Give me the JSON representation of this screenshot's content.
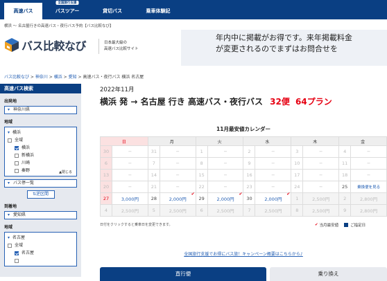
{
  "nav": {
    "tabs": [
      {
        "label": "高速バス"
      },
      {
        "label": "バスツアー",
        "badge": "全国旅行支援"
      },
      {
        "label": "貸切バス"
      },
      {
        "label": "乗車体験記"
      }
    ]
  },
  "top_breadcrumb": "横浜 〜 名古屋行きの高速バス・夜行バス予約【バス比較なび】",
  "logo": {
    "text": "バス比較なび",
    "sub_line1": "日本最大級の",
    "sub_line2": "高速バス比較サイト"
  },
  "ad": {
    "line1": "年内中に掲載がお得です。来年掲載料金",
    "line2": "が変更されるのでまずはお問合せを"
  },
  "breadcrumb": {
    "items": [
      "バス比較なび",
      "神奈川",
      "横浜",
      "愛知",
      "高速バス・夜行バス 横浜 名古屋"
    ],
    "sep": " > "
  },
  "sidebar": {
    "title": "高速バス検索",
    "departure_label": "出発地",
    "departure_pref": "神奈川県",
    "region_label": "地域",
    "departure_region": "横浜",
    "departure_options": [
      {
        "label": "全域",
        "checked": false,
        "indent": false
      },
      {
        "label": "横浜",
        "checked": true,
        "indent": true
      },
      {
        "label": "新横浜",
        "checked": false,
        "indent": true
      },
      {
        "label": "川崎",
        "checked": false,
        "indent": true
      },
      {
        "label": "秦野",
        "checked": false,
        "indent": true
      }
    ],
    "close_label": "▲閉じる",
    "stop_list": "バス停一覧",
    "swap_label": "⇅逆区間",
    "arrival_label": "到着地",
    "arrival_pref": "愛知県",
    "arrival_region_label": "地域",
    "arrival_region": "名古屋",
    "arrival_options": [
      {
        "label": "全域",
        "checked": false,
        "indent": false
      },
      {
        "label": "名古屋",
        "checked": true,
        "indent": true
      },
      {
        "label": "",
        "checked": false,
        "indent": true
      }
    ]
  },
  "main": {
    "date": "2022年11月",
    "title_prefix": "横浜 発 → 名古屋 行き 高速バス・夜行バス",
    "count_runs": "32便",
    "count_plans": "64プラン"
  },
  "calendar": {
    "title": "11月最安値カレンダー",
    "headers": [
      "日",
      "月",
      "火",
      "水",
      "木",
      "金"
    ],
    "rows": [
      [
        {
          "d": "30",
          "p": "−"
        },
        {
          "d": "31",
          "p": "−"
        },
        {
          "d": "1",
          "p": "−"
        },
        {
          "d": "2",
          "p": "−"
        },
        {
          "d": "3",
          "p": "−"
        },
        {
          "d": "4",
          "p": "−"
        }
      ],
      [
        {
          "d": "6",
          "p": "−"
        },
        {
          "d": "7",
          "p": "−"
        },
        {
          "d": "8",
          "p": "−"
        },
        {
          "d": "9",
          "p": "−"
        },
        {
          "d": "10",
          "p": "−"
        },
        {
          "d": "11",
          "p": "−"
        }
      ],
      [
        {
          "d": "13",
          "p": "−"
        },
        {
          "d": "14",
          "p": "−"
        },
        {
          "d": "15",
          "p": "−"
        },
        {
          "d": "16",
          "p": "−"
        },
        {
          "d": "17",
          "p": "−"
        },
        {
          "d": "18",
          "p": "−"
        }
      ],
      [
        {
          "d": "20",
          "p": "−"
        },
        {
          "d": "21",
          "p": "−"
        },
        {
          "d": "22",
          "p": "−"
        },
        {
          "d": "23",
          "p": "−"
        },
        {
          "d": "24",
          "p": "−"
        },
        {
          "d": "25",
          "p": "乗換便を見る"
        }
      ],
      [
        {
          "d": "27",
          "p": "3,000円"
        },
        {
          "d": "28",
          "p": "2,000円"
        },
        {
          "d": "29",
          "p": "2,000円"
        },
        {
          "d": "30",
          "p": "2,000円"
        },
        {
          "d": "1",
          "p": "2,500円"
        },
        {
          "d": "2",
          "p": "2,800円"
        }
      ],
      [
        {
          "d": "4",
          "p": "2,500円"
        },
        {
          "d": "5",
          "p": "2,500円"
        },
        {
          "d": "6",
          "p": "2,500円"
        },
        {
          "d": "7",
          "p": "2,500円"
        },
        {
          "d": "8",
          "p": "2,500円"
        },
        {
          "d": "9",
          "p": "2,800円"
        }
      ]
    ],
    "note": "日付をクリックすると乗車日を変更できます。",
    "legend_cheapest": "当月最安値",
    "legend_selected": "ご指定日"
  },
  "campaign_link": "全国旅行支援でお得にバス旅！キャンペーン概要はこちらから♪",
  "buttons": {
    "direct": "直行便",
    "transfer": "乗り換え"
  },
  "colors": {
    "brand": "#0a3f83",
    "accent_red": "#e60012",
    "link": "#2560b4"
  }
}
